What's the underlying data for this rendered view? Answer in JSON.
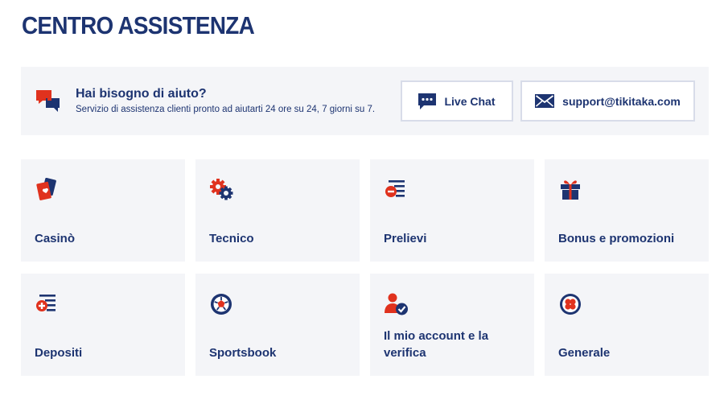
{
  "page": {
    "title": "CENTRO ASSISTENZA"
  },
  "help_banner": {
    "title": "Hai bisogno di aiuto?",
    "subtitle": "Servizio di assistenza clienti pronto ad aiutarti 24 ore su 24, 7 giorni su 7.",
    "icon": "chat-bubbles-icon",
    "live_chat": {
      "label": "Live Chat",
      "icon": "chat-icon"
    },
    "email": {
      "label": "support@tikitaka.com",
      "icon": "envelope-icon"
    }
  },
  "categories": [
    {
      "label": "Casinò",
      "icon": "playing-cards-icon"
    },
    {
      "label": "Tecnico",
      "icon": "gears-icon"
    },
    {
      "label": "Prelievi",
      "icon": "withdraw-list-icon"
    },
    {
      "label": "Bonus e promozioni",
      "icon": "gift-icon"
    },
    {
      "label": "Depositi",
      "icon": "deposit-list-icon"
    },
    {
      "label": "Sportsbook",
      "icon": "football-icon"
    },
    {
      "label": "Il mio account e la verifica",
      "icon": "user-verified-icon"
    },
    {
      "label": "Generale",
      "icon": "clover-icon"
    }
  ],
  "colors": {
    "primary": "#1d3471",
    "accent": "#e0321e",
    "card_background": "#f4f5f8",
    "button_border": "#d8dce9"
  }
}
